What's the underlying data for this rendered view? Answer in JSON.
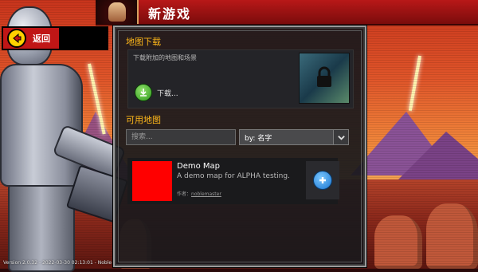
{
  "header": {
    "title": "新游戏"
  },
  "back_button": {
    "label": "返回"
  },
  "download_section": {
    "title": "地图下载",
    "description": "下载附加的地图和场景",
    "download_label": "下载..."
  },
  "available_section": {
    "title": "可用地图",
    "search_placeholder": "搜索...",
    "sort_label": "by: 名字"
  },
  "maps": [
    {
      "name": "Demo Map",
      "description": "A demo map for ALPHA testing.",
      "author_prefix": "作者：",
      "author": "noblemaster",
      "thumbnail_color": "#ff0000"
    }
  ],
  "footer": {
    "version_text": "Version 2.0.32 - 2022-03-30 02:13:01 - Noble"
  },
  "icons": {
    "back": "arrow-left-icon",
    "download": "download-arrow-icon",
    "lock": "lock-icon",
    "sort": "chevron-down-icon",
    "add": "plus-icon"
  },
  "colors": {
    "accent_red": "#c01616",
    "section_title": "#ffb81a",
    "back_icon": "#ffd100",
    "download_green": "#2e9a1c",
    "add_blue": "#1a74d0"
  }
}
